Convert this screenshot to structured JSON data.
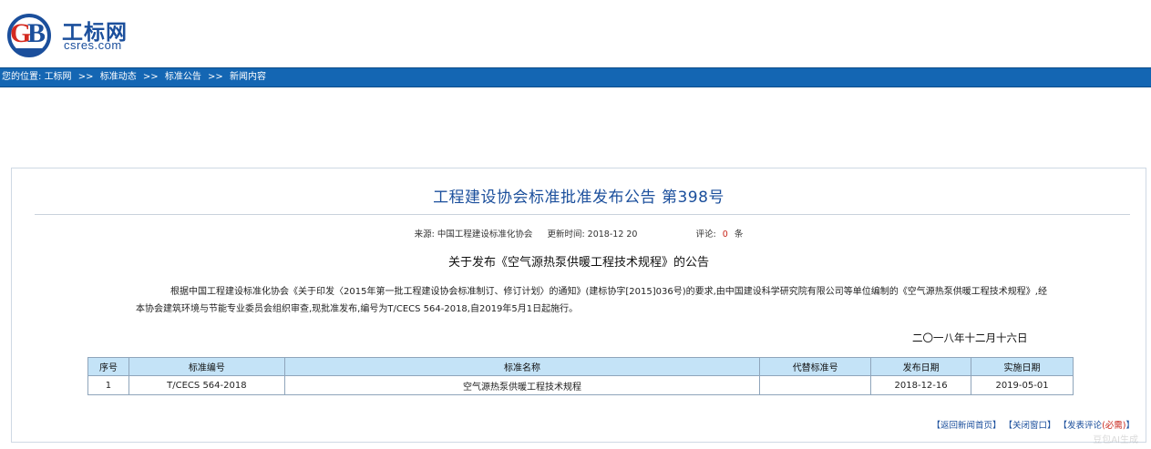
{
  "site": {
    "logo_cn": "工标网",
    "logo_en": "csres.com"
  },
  "breadcrumb": {
    "prefix": "您的位置:",
    "items": [
      "工标网",
      "标准动态",
      "标准公告",
      "新闻内容"
    ],
    "separator": ">>"
  },
  "notice": {
    "title": "工程建设协会标准批准发布公告 第398号",
    "meta": {
      "source_label": "来源:",
      "source": "中国工程建设标准化协会",
      "update_label": "更新时间:",
      "update_time": "2018-12 20",
      "comment_label": "评论:",
      "comment_count": "0",
      "comment_unit": "条"
    },
    "subtitle": "关于发布《空气源热泵供暖工程技术规程》的公告",
    "body": "根据中国工程建设标准化协会《关于印发〈2015年第一批工程建设协会标准制订、修订计划〉的通知》(建标协字[2015]036号)的要求,由中国建设科学研究院有限公司等单位编制的《空气源热泵供暖工程技术规程》,经本协会建筑环境与节能专业委员会组织审查,现批准发布,编号为T/CECS 564-2018,自2019年5月1日起施行。",
    "date": "二〇一八年十二月十六日"
  },
  "table": {
    "headers": [
      "序号",
      "标准编号",
      "标准名称",
      "代替标准号",
      "发布日期",
      "实施日期"
    ],
    "rows": [
      [
        "1",
        "T/CECS 564-2018",
        "空气源热泵供暖工程技术规程",
        "",
        "2018-12-16",
        "2019-05-01"
      ]
    ]
  },
  "footer": {
    "links": [
      "【返回新闻首页】",
      "【关闭窗口】",
      "【发表评论"
    ],
    "hint": "(必需)",
    "close_bracket": "】"
  },
  "watermark": "豆包AI生成",
  "colors": {
    "brand": "#1b4f9c",
    "nav_bar": "#1466b3",
    "table_header": "#c4e3f7",
    "accent_red": "#c8261b"
  }
}
